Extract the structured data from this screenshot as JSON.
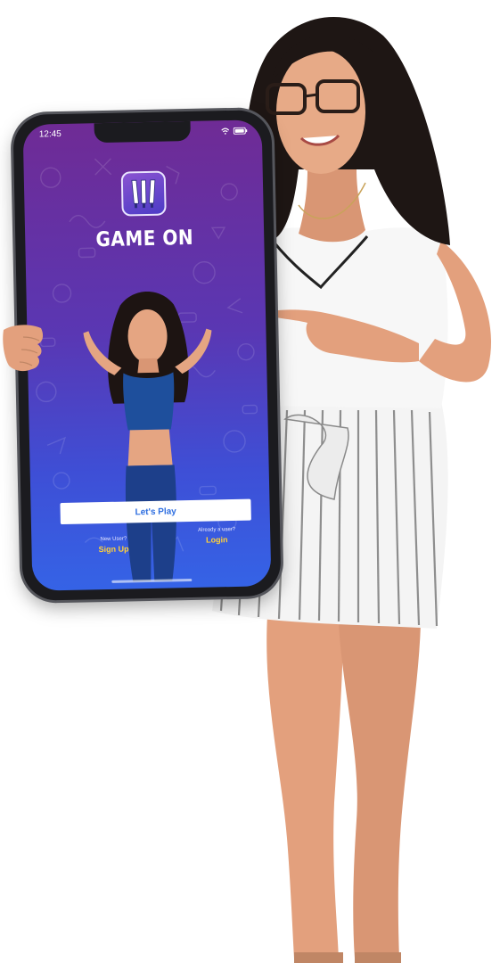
{
  "status_bar": {
    "time": "12:45"
  },
  "app": {
    "title": "GAME ON",
    "logo_icon": "cricket-bats-logo-icon"
  },
  "actions": {
    "play_label": "Let's Play",
    "new_user_caption": "New User?",
    "signup_label": "Sign Up",
    "existing_user_caption": "Already a user?",
    "login_label": "Login"
  },
  "colors": {
    "gradient_top": "#6f2b95",
    "gradient_bottom": "#3563e6",
    "accent_yellow": "#ffd13a",
    "button_text": "#2f6fe0"
  }
}
